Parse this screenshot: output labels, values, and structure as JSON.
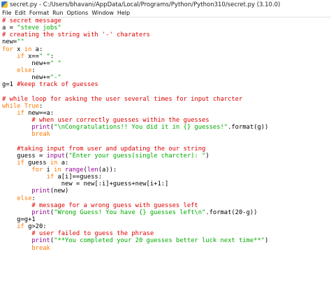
{
  "window": {
    "title": "secret.py - C:/Users/bhavani/AppData/Local/Programs/Python/Python310/secret.py (3.10.0)",
    "icon": "python-idle-icon"
  },
  "menu": [
    "File",
    "Edit",
    "Format",
    "Run",
    "Options",
    "Window",
    "Help"
  ],
  "colors": {
    "keyword": "#ff7700",
    "string": "#00aa00",
    "comment": "#dd0000",
    "builtin": "#900090",
    "default": "#000000"
  },
  "code_lines": [
    [
      [
        "com",
        "# secret message"
      ]
    ],
    [
      [
        "def",
        "a = "
      ],
      [
        "str",
        "\"steve jobs\""
      ]
    ],
    [
      [
        "com",
        "# creating the string with '-' charaters"
      ]
    ],
    [
      [
        "def",
        "new="
      ],
      [
        "str",
        "\"\""
      ]
    ],
    [
      [
        "kw",
        "for"
      ],
      [
        "def",
        " x "
      ],
      [
        "kw",
        "in"
      ],
      [
        "def",
        " a:"
      ]
    ],
    [
      [
        "def",
        "    "
      ],
      [
        "kw",
        "if"
      ],
      [
        "def",
        " x=="
      ],
      [
        "str",
        "\" \""
      ],
      [
        "def",
        ":"
      ]
    ],
    [
      [
        "def",
        "        new+="
      ],
      [
        "str",
        "\" \""
      ]
    ],
    [
      [
        "def",
        "    "
      ],
      [
        "kw",
        "else"
      ],
      [
        "def",
        ":"
      ]
    ],
    [
      [
        "def",
        "        new+="
      ],
      [
        "str",
        "\"-\""
      ]
    ],
    [
      [
        "def",
        "g=1 "
      ],
      [
        "com",
        "#keep track of guesses"
      ]
    ],
    [
      [
        "def",
        ""
      ]
    ],
    [
      [
        "com",
        "# while loop for asking the user several times for input charcter"
      ]
    ],
    [
      [
        "kw",
        "while"
      ],
      [
        "def",
        " "
      ],
      [
        "kw",
        "True"
      ],
      [
        "def",
        ":"
      ]
    ],
    [
      [
        "def",
        "    "
      ],
      [
        "kw",
        "if"
      ],
      [
        "def",
        " new==a:"
      ]
    ],
    [
      [
        "def",
        "        "
      ],
      [
        "com",
        "# when user correctly guesses within the guesses"
      ]
    ],
    [
      [
        "def",
        "        "
      ],
      [
        "bi",
        "print"
      ],
      [
        "def",
        "("
      ],
      [
        "str",
        "\"\\nCongratulations!! You did it in {} guesses!\""
      ],
      [
        "def",
        ".format(g))"
      ]
    ],
    [
      [
        "def",
        "        "
      ],
      [
        "kw",
        "break"
      ]
    ],
    [
      [
        "def",
        ""
      ]
    ],
    [
      [
        "def",
        "    "
      ],
      [
        "com",
        "#taking input from user and updating the our string"
      ]
    ],
    [
      [
        "def",
        "    guess = "
      ],
      [
        "bi",
        "input"
      ],
      [
        "def",
        "("
      ],
      [
        "str",
        "\"Enter your guess(single charcter): \""
      ],
      [
        "def",
        ")"
      ]
    ],
    [
      [
        "def",
        "    "
      ],
      [
        "kw",
        "if"
      ],
      [
        "def",
        " guess "
      ],
      [
        "kw",
        "in"
      ],
      [
        "def",
        " a:"
      ]
    ],
    [
      [
        "def",
        "        "
      ],
      [
        "kw",
        "for"
      ],
      [
        "def",
        " i "
      ],
      [
        "kw",
        "in"
      ],
      [
        "def",
        " "
      ],
      [
        "bi",
        "range"
      ],
      [
        "def",
        "("
      ],
      [
        "bi",
        "len"
      ],
      [
        "def",
        "(a)):"
      ]
    ],
    [
      [
        "def",
        "            "
      ],
      [
        "kw",
        "if"
      ],
      [
        "def",
        " a[i]==guess:"
      ]
    ],
    [
      [
        "def",
        "                new = new[:i]+guess+new[i+1:]"
      ]
    ],
    [
      [
        "def",
        "        "
      ],
      [
        "bi",
        "print"
      ],
      [
        "def",
        "(new)"
      ]
    ],
    [
      [
        "def",
        "    "
      ],
      [
        "kw",
        "else"
      ],
      [
        "def",
        ":"
      ]
    ],
    [
      [
        "def",
        "        "
      ],
      [
        "com",
        "# message for a wrong guess with guesses left"
      ]
    ],
    [
      [
        "def",
        "        "
      ],
      [
        "bi",
        "print"
      ],
      [
        "def",
        "("
      ],
      [
        "str",
        "\"Wrong Guess! You have {} guesses left\\n\""
      ],
      [
        "def",
        ".format(20-g))"
      ]
    ],
    [
      [
        "def",
        "    g=g+1"
      ]
    ],
    [
      [
        "def",
        "    "
      ],
      [
        "kw",
        "if"
      ],
      [
        "def",
        " g>20:"
      ]
    ],
    [
      [
        "def",
        "        "
      ],
      [
        "com",
        "# user failed to guess the phrase"
      ]
    ],
    [
      [
        "def",
        "        "
      ],
      [
        "bi",
        "print"
      ],
      [
        "def",
        "("
      ],
      [
        "str",
        "\"**You completed your 20 guesses better luck next time**\""
      ],
      [
        "def",
        ")"
      ]
    ],
    [
      [
        "def",
        "        "
      ],
      [
        "kw",
        "break"
      ]
    ]
  ]
}
